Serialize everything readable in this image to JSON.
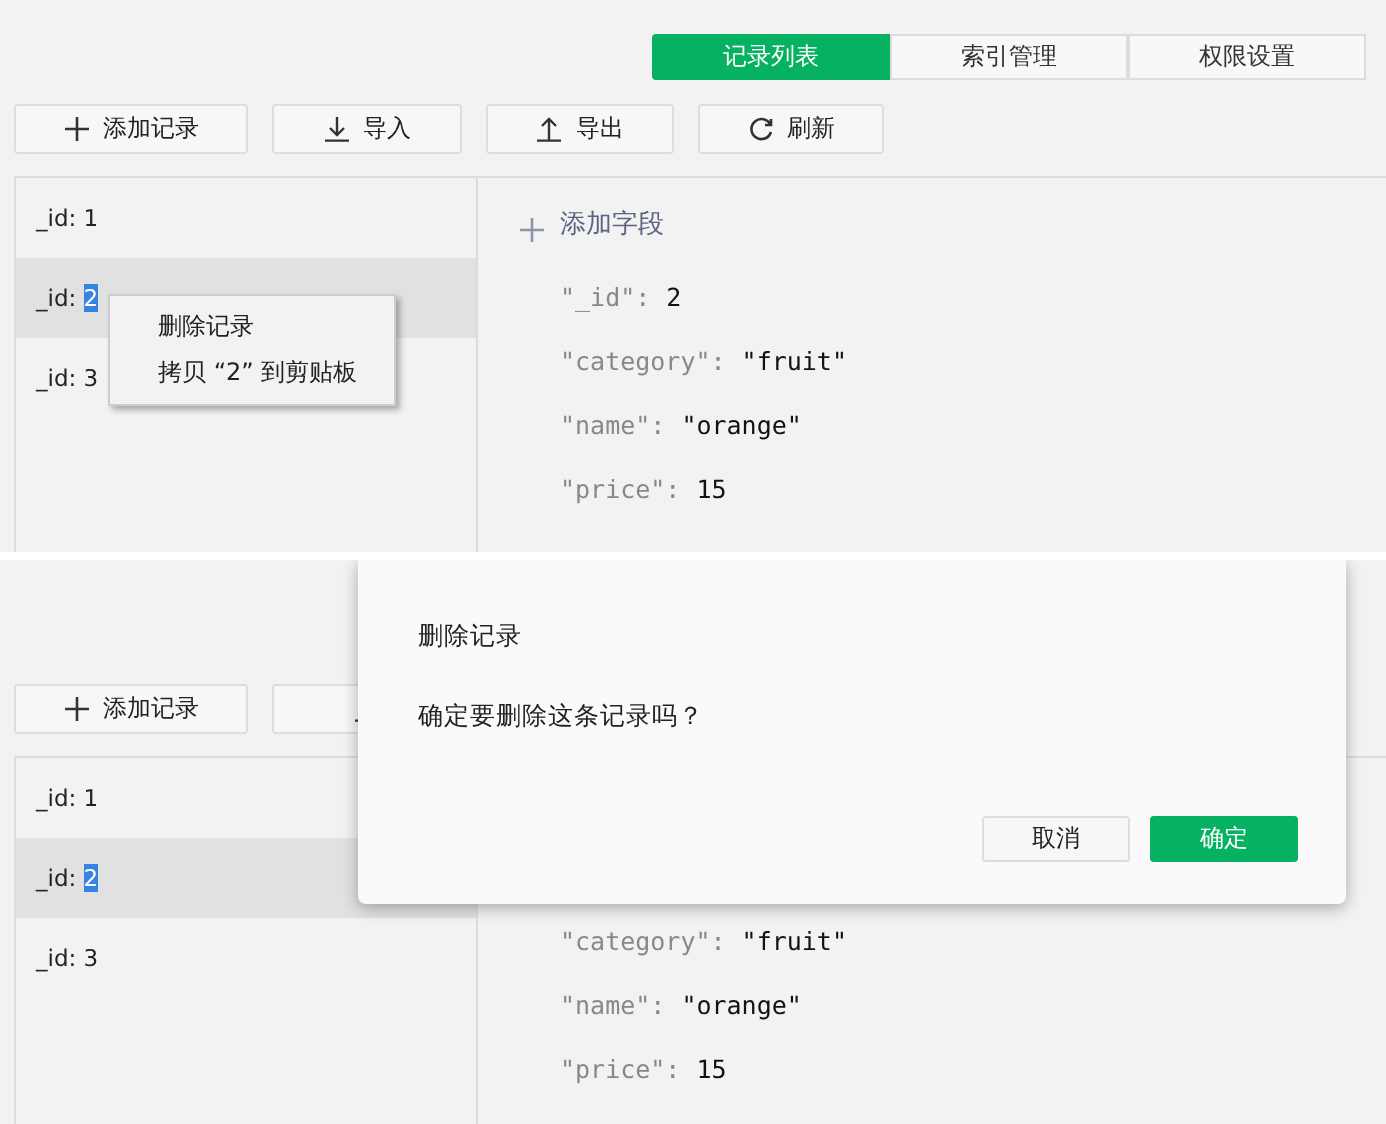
{
  "panels": [
    {
      "tabs": [
        {
          "label": "记录列表",
          "selected": true
        },
        {
          "label": "索引管理",
          "selected": false
        },
        {
          "label": "权限设置",
          "selected": false
        }
      ],
      "toolbar": [
        {
          "label": "添加记录"
        },
        {
          "label": "导入"
        },
        {
          "label": "导出"
        },
        {
          "label": "刷新"
        }
      ],
      "records": [
        {
          "key": "_id: ",
          "value": "1",
          "selected": false,
          "value_highlighted": false
        },
        {
          "key": "_id: ",
          "value": "2",
          "selected": true,
          "value_highlighted": true
        },
        {
          "key": "_id: ",
          "value": "3",
          "selected": false,
          "value_highlighted": false
        }
      ],
      "add_field": "添加字段",
      "fields": [
        {
          "key": "\"_id\":",
          "value": "2"
        },
        {
          "key": "\"category\":",
          "value": "\"fruit\""
        },
        {
          "key": "\"name\":",
          "value": "\"orange\""
        },
        {
          "key": "\"price\":",
          "value": "15"
        }
      ],
      "context_menu": {
        "items": [
          "删除记录",
          "拷贝 “2” 到剪贴板"
        ]
      }
    },
    {
      "toolbar": [
        {
          "label": "添加记录"
        }
      ],
      "records": [
        {
          "key": "_id: ",
          "value": "1",
          "selected": false,
          "value_highlighted": false
        },
        {
          "key": "_id: ",
          "value": "2",
          "selected": true,
          "value_highlighted": true
        },
        {
          "key": "_id: ",
          "value": "3",
          "selected": false,
          "value_highlighted": false
        }
      ],
      "fields": [
        {
          "key": "\"category\":",
          "value": "\"fruit\""
        },
        {
          "key": "\"name\":",
          "value": "\"orange\""
        },
        {
          "key": "\"price\":",
          "value": "15"
        }
      ],
      "dialog": {
        "title": "删除记录",
        "message": "确定要删除这条记录吗？",
        "buttons": [
          {
            "label": "取消",
            "kind": "secondary"
          },
          {
            "label": "确定",
            "kind": "primary"
          }
        ]
      }
    }
  ]
}
